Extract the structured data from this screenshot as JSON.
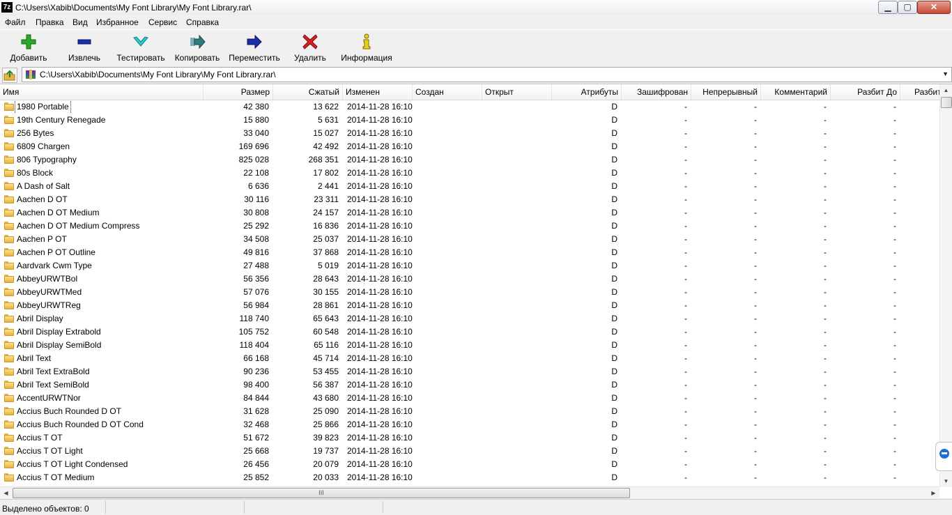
{
  "window": {
    "title": "C:\\Users\\Xabib\\Documents\\My Font Library\\My Font Library.rar\\",
    "app_icon_label": "7z",
    "minimize_glyph": "▁",
    "maximize_glyph": "▢",
    "close_glyph": "✕"
  },
  "menu": [
    "Файл",
    "Правка",
    "Вид",
    "Избранное",
    "Сервис",
    "Справка"
  ],
  "toolbar": {
    "add": "Добавить",
    "extract": "Извлечь",
    "test": "Тестировать",
    "copy": "Копировать",
    "move": "Переместить",
    "delete": "Удалить",
    "info": "Информация"
  },
  "address": {
    "path": "C:\\Users\\Xabib\\Documents\\My Font Library\\My Font Library.rar\\",
    "dropdown_glyph": "▼"
  },
  "columns": [
    "Имя",
    "Размер",
    "Сжатый",
    "Изменен",
    "Создан",
    "Открыт",
    "Атрибуты",
    "Зашифрован",
    "Непрерывный",
    "Комментарий",
    "Разбит До",
    "Разбит"
  ],
  "rows": [
    {
      "name": "1980 Portable",
      "size": "42 380",
      "packed": "13 622",
      "modified": "2014-11-28 16:10",
      "attr": "D",
      "enc": "-",
      "solid": "-",
      "comment": "-",
      "split": "-"
    },
    {
      "name": "19th Century Renegade",
      "size": "15 880",
      "packed": "5 631",
      "modified": "2014-11-28 16:10",
      "attr": "D",
      "enc": "-",
      "solid": "-",
      "comment": "-",
      "split": "-"
    },
    {
      "name": "256 Bytes",
      "size": "33 040",
      "packed": "15 027",
      "modified": "2014-11-28 16:10",
      "attr": "D",
      "enc": "-",
      "solid": "-",
      "comment": "-",
      "split": "-"
    },
    {
      "name": "6809 Chargen",
      "size": "169 696",
      "packed": "42 492",
      "modified": "2014-11-28 16:10",
      "attr": "D",
      "enc": "-",
      "solid": "-",
      "comment": "-",
      "split": "-"
    },
    {
      "name": "806 Typography",
      "size": "825 028",
      "packed": "268 351",
      "modified": "2014-11-28 16:10",
      "attr": "D",
      "enc": "-",
      "solid": "-",
      "comment": "-",
      "split": "-"
    },
    {
      "name": "80s Block",
      "size": "22 108",
      "packed": "17 802",
      "modified": "2014-11-28 16:10",
      "attr": "D",
      "enc": "-",
      "solid": "-",
      "comment": "-",
      "split": "-"
    },
    {
      "name": "A Dash of Salt",
      "size": "6 636",
      "packed": "2 441",
      "modified": "2014-11-28 16:10",
      "attr": "D",
      "enc": "-",
      "solid": "-",
      "comment": "-",
      "split": "-"
    },
    {
      "name": "Aachen D OT",
      "size": "30 116",
      "packed": "23 311",
      "modified": "2014-11-28 16:10",
      "attr": "D",
      "enc": "-",
      "solid": "-",
      "comment": "-",
      "split": "-"
    },
    {
      "name": "Aachen D OT Medium",
      "size": "30 808",
      "packed": "24 157",
      "modified": "2014-11-28 16:10",
      "attr": "D",
      "enc": "-",
      "solid": "-",
      "comment": "-",
      "split": "-"
    },
    {
      "name": "Aachen D OT Medium Compress",
      "size": "25 292",
      "packed": "16 836",
      "modified": "2014-11-28 16:10",
      "attr": "D",
      "enc": "-",
      "solid": "-",
      "comment": "-",
      "split": "-"
    },
    {
      "name": "Aachen P OT",
      "size": "34 508",
      "packed": "25 037",
      "modified": "2014-11-28 16:10",
      "attr": "D",
      "enc": "-",
      "solid": "-",
      "comment": "-",
      "split": "-"
    },
    {
      "name": "Aachen P OT Outline",
      "size": "49 816",
      "packed": "37 868",
      "modified": "2014-11-28 16:10",
      "attr": "D",
      "enc": "-",
      "solid": "-",
      "comment": "-",
      "split": "-"
    },
    {
      "name": "Aardvark Cwm Type",
      "size": "27 488",
      "packed": "5 019",
      "modified": "2014-11-28 16:10",
      "attr": "D",
      "enc": "-",
      "solid": "-",
      "comment": "-",
      "split": "-"
    },
    {
      "name": "AbbeyURWTBol",
      "size": "56 356",
      "packed": "28 643",
      "modified": "2014-11-28 16:10",
      "attr": "D",
      "enc": "-",
      "solid": "-",
      "comment": "-",
      "split": "-"
    },
    {
      "name": "AbbeyURWTMed",
      "size": "57 076",
      "packed": "30 155",
      "modified": "2014-11-28 16:10",
      "attr": "D",
      "enc": "-",
      "solid": "-",
      "comment": "-",
      "split": "-"
    },
    {
      "name": "AbbeyURWTReg",
      "size": "56 984",
      "packed": "28 861",
      "modified": "2014-11-28 16:10",
      "attr": "D",
      "enc": "-",
      "solid": "-",
      "comment": "-",
      "split": "-"
    },
    {
      "name": "Abril Display",
      "size": "118 740",
      "packed": "65 643",
      "modified": "2014-11-28 16:10",
      "attr": "D",
      "enc": "-",
      "solid": "-",
      "comment": "-",
      "split": "-"
    },
    {
      "name": "Abril Display Extrabold",
      "size": "105 752",
      "packed": "60 548",
      "modified": "2014-11-28 16:10",
      "attr": "D",
      "enc": "-",
      "solid": "-",
      "comment": "-",
      "split": "-"
    },
    {
      "name": "Abril Display SemiBold",
      "size": "118 404",
      "packed": "65 116",
      "modified": "2014-11-28 16:10",
      "attr": "D",
      "enc": "-",
      "solid": "-",
      "comment": "-",
      "split": "-"
    },
    {
      "name": "Abril Text",
      "size": "66 168",
      "packed": "45 714",
      "modified": "2014-11-28 16:10",
      "attr": "D",
      "enc": "-",
      "solid": "-",
      "comment": "-",
      "split": "-"
    },
    {
      "name": "Abril Text ExtraBold",
      "size": "90 236",
      "packed": "53 455",
      "modified": "2014-11-28 16:10",
      "attr": "D",
      "enc": "-",
      "solid": "-",
      "comment": "-",
      "split": "-"
    },
    {
      "name": "Abril Text SemiBold",
      "size": "98 400",
      "packed": "56 387",
      "modified": "2014-11-28 16:10",
      "attr": "D",
      "enc": "-",
      "solid": "-",
      "comment": "-",
      "split": "-"
    },
    {
      "name": "AccentURWTNor",
      "size": "84 844",
      "packed": "43 680",
      "modified": "2014-11-28 16:10",
      "attr": "D",
      "enc": "-",
      "solid": "-",
      "comment": "-",
      "split": "-"
    },
    {
      "name": "Accius Buch Rounded D OT",
      "size": "31 628",
      "packed": "25 090",
      "modified": "2014-11-28 16:10",
      "attr": "D",
      "enc": "-",
      "solid": "-",
      "comment": "-",
      "split": "-"
    },
    {
      "name": "Accius Buch Rounded D OT Cond",
      "size": "32 468",
      "packed": "25 866",
      "modified": "2014-11-28 16:10",
      "attr": "D",
      "enc": "-",
      "solid": "-",
      "comment": "-",
      "split": "-"
    },
    {
      "name": "Accius T OT",
      "size": "51 672",
      "packed": "39 823",
      "modified": "2014-11-28 16:10",
      "attr": "D",
      "enc": "-",
      "solid": "-",
      "comment": "-",
      "split": "-"
    },
    {
      "name": "Accius T OT Light",
      "size": "25 668",
      "packed": "19 737",
      "modified": "2014-11-28 16:10",
      "attr": "D",
      "enc": "-",
      "solid": "-",
      "comment": "-",
      "split": "-"
    },
    {
      "name": "Accius T OT Light Condensed",
      "size": "26 456",
      "packed": "20 079",
      "modified": "2014-11-28 16:10",
      "attr": "D",
      "enc": "-",
      "solid": "-",
      "comment": "-",
      "split": "-"
    },
    {
      "name": "Accius T OT Medium",
      "size": "25 852",
      "packed": "20 033",
      "modified": "2014-11-28 16:10",
      "attr": "D",
      "enc": "-",
      "solid": "-",
      "comment": "-",
      "split": "-"
    }
  ],
  "hscroll_grip": "III",
  "status": {
    "selected": "Выделено объектов: 0"
  },
  "icons": {
    "add": "plus-icon",
    "extract": "minus-icon",
    "test": "check-icon",
    "copy": "copy-arrow-icon",
    "move": "move-arrow-icon",
    "delete": "delete-x-icon",
    "info": "info-icon",
    "folder": "folder-icon"
  },
  "colors": {
    "add_green": "#2aa82a",
    "extract_blue": "#1a2fa8",
    "test_cyan": "#2cc9d6",
    "delete_red": "#d62020",
    "info_yellow": "#e8d21a"
  }
}
